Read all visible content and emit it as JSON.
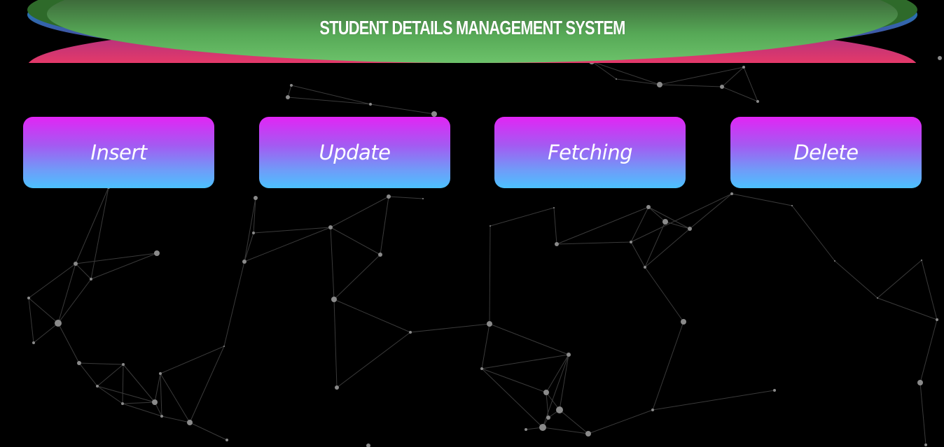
{
  "header": {
    "title": "STUDENT DETAILS MANAGEMENT SYSTEM"
  },
  "actions": {
    "insert_label": "Insert",
    "update_label": "Update",
    "fetch_label": "Fetching",
    "delete_label": "Delete"
  },
  "colors": {
    "background": "#000000",
    "header_green": "#6cc26a",
    "header_blue": "#2a6fb0",
    "header_red": "#e8395f",
    "button_top": "#e225f5",
    "button_bottom": "#4cc1ff",
    "network_line": "#3a3a3a",
    "network_node": "#8a8a8a"
  }
}
